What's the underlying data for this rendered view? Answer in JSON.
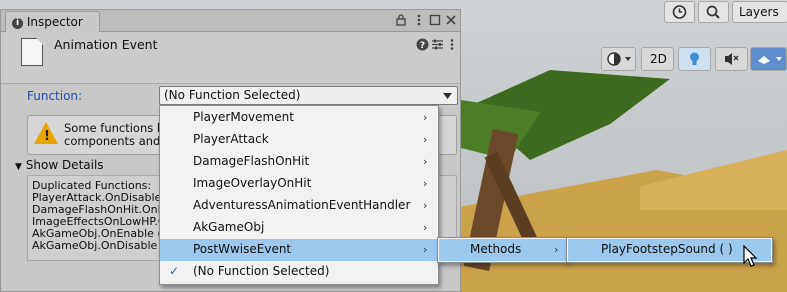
{
  "toolbar": {
    "history_icon": "history-icon",
    "search_icon": "search-icon",
    "layers_label": "Layers"
  },
  "scene_toolbar": {
    "mode_2d": "2D"
  },
  "inspector": {
    "tab_label": "Inspector",
    "component_title": "Animation Event",
    "function_label": "Function:",
    "function_value": "(No Function Selected)",
    "warning_line1": "Some functions hav",
    "warning_line2": "components and ma",
    "show_details_label": "Show Details",
    "details_lines": [
      "Duplicated Functions:",
      "PlayerAttack.OnDisable ( )",
      "DamageFlashOnHit.OnEnab",
      "ImageEffectsOnLowHP.On",
      "AkGameObj.OnEnable ( )",
      "AkGameObj.OnDisable ( )"
    ]
  },
  "function_menu": {
    "items": [
      {
        "label": "PlayerMovement",
        "submenu": true
      },
      {
        "label": "PlayerAttack",
        "submenu": true
      },
      {
        "label": "DamageFlashOnHit",
        "submenu": true
      },
      {
        "label": "ImageOverlayOnHit",
        "submenu": true
      },
      {
        "label": "AdventuressAnimationEventHandler",
        "submenu": true
      },
      {
        "label": "AkGameObj",
        "submenu": true
      },
      {
        "label": "PostWwiseEvent",
        "submenu": true,
        "highlighted": true
      },
      {
        "label": "(No Function Selected)",
        "submenu": false,
        "checked": true
      }
    ],
    "check_glyph": "✓",
    "submenu_glyph": "›"
  },
  "methods_menu": {
    "items": [
      {
        "label": "Methods",
        "submenu": true,
        "highlighted": true
      }
    ]
  },
  "methods_submenu": {
    "items": [
      {
        "label": "PlayFootstepSound ( )",
        "highlighted": true
      }
    ]
  },
  "colors": {
    "highlight": "#9cc7ee",
    "label_blue": "#1f4ea8",
    "warning": "#e8a400"
  }
}
